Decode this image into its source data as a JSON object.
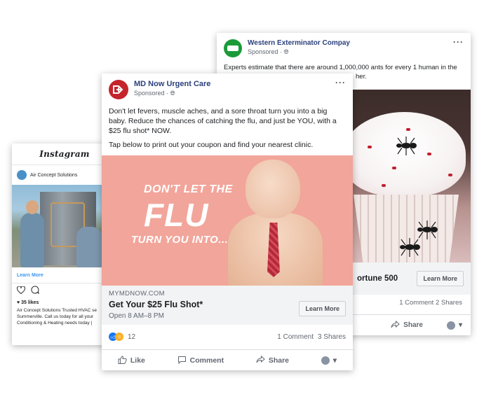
{
  "instagram": {
    "logo": "Instagram",
    "account": "Air Concept Solutions",
    "learn_more": "Learn More",
    "likes": "35 likes",
    "caption": "Air Concept Solutions  Trusted HVAC se Summerville. Call us today for all your Conditioning & Heating needs today |"
  },
  "western": {
    "name": "Western Exterminator Compay",
    "sponsored": "Sponsored ·",
    "body_line1": "Experts estimate that there are around 1,000,000 ants for every 1 human in the",
    "body_line2": "her.",
    "headline": "ortune 500",
    "cta": "Learn More",
    "comments": "1 Comment",
    "shares": "2 Shares",
    "share": "Share",
    "more": "···"
  },
  "mdnow": {
    "name": "MD Now Urgent Care",
    "sponsored": "Sponsored ·",
    "more": "···",
    "body_p1": "Don't let fevers, muscle aches, and a sore throat turn you into a big baby. Reduce the chances of catching the flu, and just be YOU, with a $25 flu shot* NOW.",
    "body_p2": "Tap below to print out your coupon and find your nearest clinic.",
    "image_text_1": "DON'T LET THE",
    "image_text_2": "FLU",
    "image_text_3": "TURN YOU INTO...",
    "url": "MYMDNOW.COM",
    "headline": "Get Your $25 Flu Shot*",
    "subline": "Open 8 AM–8 PM",
    "cta": "Learn More",
    "reactions_count": "12",
    "comments": "1 Comment",
    "shares": "3 Shares",
    "like": "Like",
    "comment": "Comment",
    "share": "Share"
  },
  "colors": {
    "facebook_blue": "#1877f2",
    "md_red": "#c4242b",
    "western_green": "#1c9a3a",
    "flu_banner_pink": "#f2a59a"
  }
}
